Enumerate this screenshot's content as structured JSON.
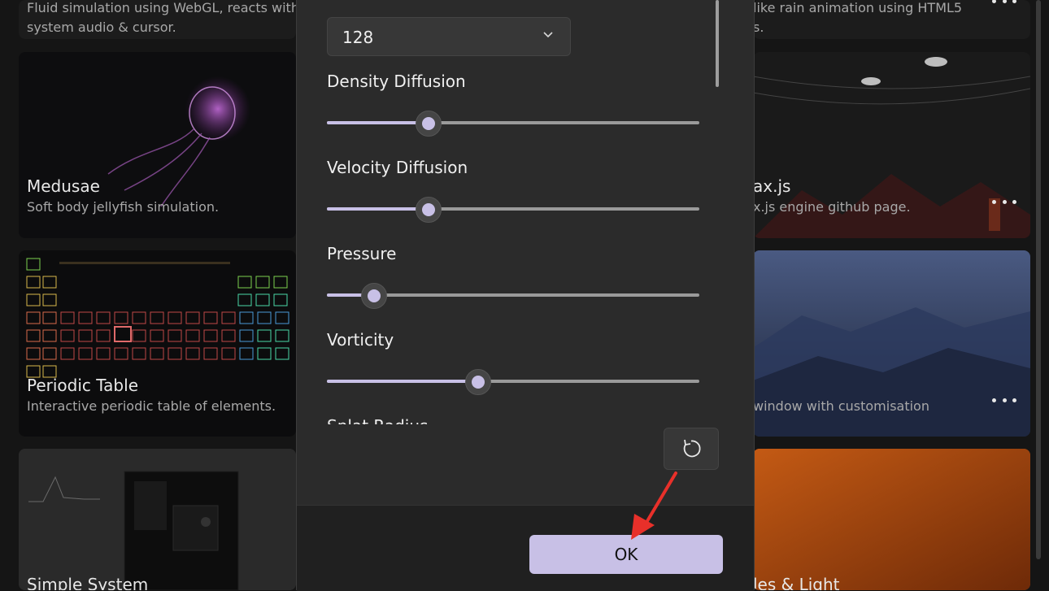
{
  "background_cards": [
    {
      "title": "",
      "desc_line1": "Fluid simulation using WebGL, reacts with",
      "desc_line2": "system audio & cursor."
    },
    {
      "title": "",
      "desc_line1": "like rain animation using HTML5",
      "desc_line2": "s."
    },
    {
      "title": "Medusae",
      "desc": "Soft body jellyfish simulation."
    },
    {
      "title": "ax.js",
      "desc": "x.js engine github page."
    },
    {
      "title": "Periodic Table",
      "desc": "Interactive periodic table of elements."
    },
    {
      "title": "",
      "desc": "window with customisation"
    },
    {
      "title": "Simple System",
      "desc": ""
    },
    {
      "title": "les & Light",
      "desc": ""
    }
  ],
  "dialog": {
    "quality_value": "128",
    "sliders": [
      {
        "label": "Density Diffusion",
        "value": 0.27
      },
      {
        "label": "Velocity Diffusion",
        "value": 0.27
      },
      {
        "label": "Pressure",
        "value": 0.125
      },
      {
        "label": "Vorticity",
        "value": 0.405
      }
    ],
    "partial_label": "Splat Radius",
    "ok_label": "OK"
  },
  "icons": {
    "dropdown": "chevron-down-icon",
    "reset": "reset-icon",
    "more": "more-icon",
    "annotation": "red-arrow-annotation"
  },
  "colors": {
    "accent": "#c8c0e6",
    "annotation": "#e8302a"
  }
}
